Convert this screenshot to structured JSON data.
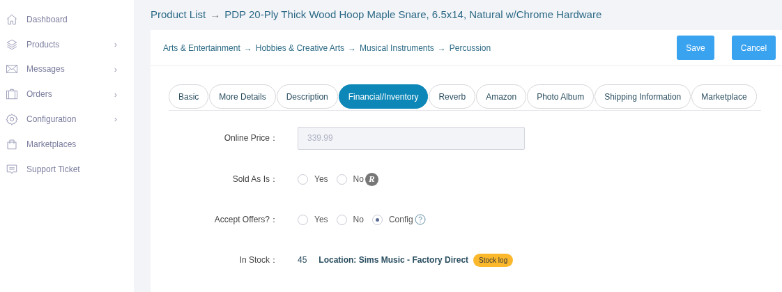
{
  "sidebar": {
    "items": [
      {
        "label": "Dashboard",
        "expandable": false
      },
      {
        "label": "Products",
        "expandable": true
      },
      {
        "label": "Messages",
        "expandable": true
      },
      {
        "label": "Orders",
        "expandable": true
      },
      {
        "label": "Configuration",
        "expandable": true
      },
      {
        "label": "Marketplaces",
        "expandable": false
      },
      {
        "label": "Support Ticket",
        "expandable": false
      }
    ],
    "chevron": "›"
  },
  "title": {
    "parts": [
      "Product List",
      "PDP 20-Ply Thick Wood Hoop Maple Snare, 6.5x14, Natural w/Chrome Hardware"
    ],
    "separator": "→"
  },
  "categories": {
    "parts": [
      "Arts & Entertainment",
      "Hobbies & Creative Arts",
      "Musical Instruments",
      "Percussion"
    ],
    "separator": "→"
  },
  "buttons": [
    "Save",
    "Cancel"
  ],
  "tabs": [
    {
      "label": "Basic",
      "selected": false
    },
    {
      "label": "More Details",
      "selected": false
    },
    {
      "label": "Description",
      "selected": false
    },
    {
      "label": "Financial/Inventory",
      "selected": true
    },
    {
      "label": "Reverb",
      "selected": false
    },
    {
      "label": "Amazon",
      "selected": false
    },
    {
      "label": "Photo Album",
      "selected": false
    },
    {
      "label": "Shipping Information",
      "selected": false
    },
    {
      "label": "Marketplace",
      "selected": false
    }
  ],
  "form": [
    {
      "kind": "input",
      "label": "Online Price：",
      "value": "339.99"
    },
    {
      "kind": "radio",
      "label": "Sold As Is：",
      "options": [
        {
          "label": "Yes",
          "selected": false
        },
        {
          "label": "No",
          "selected": false
        }
      ],
      "badge": "R"
    },
    {
      "kind": "radio",
      "label": "Accept Offers?：",
      "options": [
        {
          "label": "Yes",
          "selected": false
        },
        {
          "label": "No",
          "selected": false
        },
        {
          "label": "Config",
          "selected": true
        }
      ],
      "help": true
    },
    {
      "kind": "stock",
      "label": "In Stock：",
      "count": "45",
      "location": "Location: Sims Music - Factory Direct",
      "log": "Stock log"
    }
  ]
}
